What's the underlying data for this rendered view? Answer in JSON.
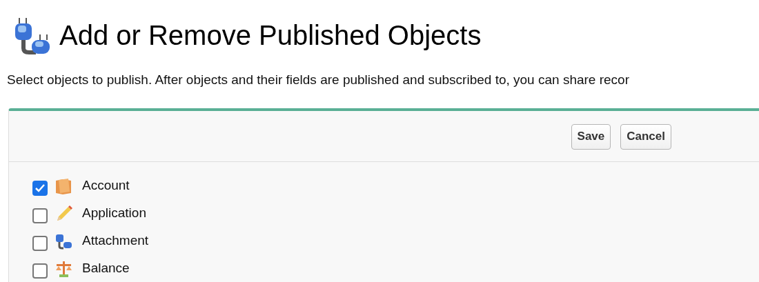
{
  "page": {
    "title": "Add or Remove Published Objects",
    "description": "Select objects to publish. After objects and their fields are published and subscribed to, you can share recor"
  },
  "buttons": [
    "Save",
    "Cancel"
  ],
  "objects": [
    {
      "label": "Account",
      "checked": true
    },
    {
      "label": "Application",
      "checked": false
    },
    {
      "label": "Attachment",
      "checked": false
    },
    {
      "label": "Balance",
      "checked": false
    }
  ]
}
